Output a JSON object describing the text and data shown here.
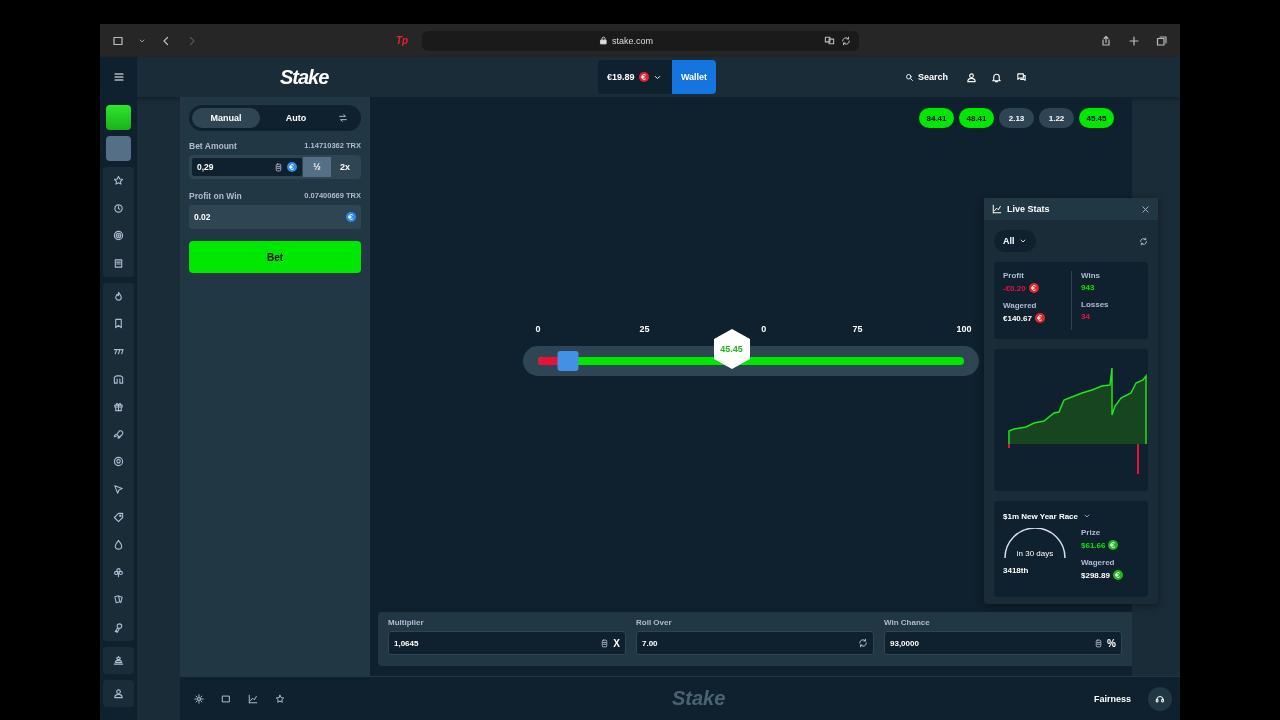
{
  "browser": {
    "extension": "Tp",
    "url": "stake.com"
  },
  "header": {
    "logo": "Stake",
    "balance": "€19.89",
    "wallet": "Wallet",
    "search": "Search"
  },
  "bet_panel": {
    "tabs": [
      {
        "label": "Manual",
        "selected": true
      },
      {
        "label": "Auto",
        "selected": false
      }
    ],
    "bet_amount": {
      "label": "Bet Amount",
      "converted": "1.14710362 TRX",
      "value": "0,29",
      "half": "½",
      "double": "2x"
    },
    "profit_on_win": {
      "label": "Profit on Win",
      "converted": "0.07400669 TRX",
      "value": "0.02"
    },
    "bet_button": "Bet"
  },
  "recent_results": [
    {
      "value": "84.41",
      "win": true
    },
    {
      "value": "48.41",
      "win": true
    },
    {
      "value": "2.13",
      "win": false
    },
    {
      "value": "1.22",
      "win": false
    },
    {
      "value": "45.45",
      "win": true
    }
  ],
  "slider": {
    "ticks": [
      "0",
      "25",
      "0",
      "75",
      "100"
    ],
    "level": 0.07,
    "result": {
      "value": "45.45",
      "level": 0.4545
    }
  },
  "live_stats": {
    "title": "Live Stats",
    "filter": "All",
    "profit_label": "Profit",
    "profit": "-€0.20",
    "wagered_label": "Wagered",
    "wagered": "€140.67",
    "wins_label": "Wins",
    "wins": "943",
    "losses_label": "Losses",
    "losses": "34"
  },
  "race": {
    "title": "$1m New Year Race",
    "countdown": "in 30 days",
    "rank": "3418th",
    "prize_label": "Prize",
    "prize": "$61.66",
    "wagered_label": "Wagered",
    "wagered": "$298.89"
  },
  "inputs": [
    {
      "label": "Multiplier",
      "value": "1,0645",
      "suffix": "X",
      "kind": "multiplier"
    },
    {
      "label": "Roll Over",
      "value": "7.00",
      "kind": "rollover"
    },
    {
      "label": "Win Chance",
      "value": "93,0000",
      "suffix": "%",
      "kind": "chance"
    }
  ],
  "footer": {
    "logo": "Stake",
    "fairness": "Fairness"
  }
}
